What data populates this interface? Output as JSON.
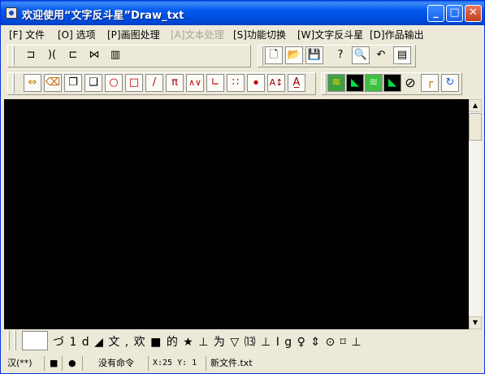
{
  "window": {
    "title": "欢迎使用“文字反斗星”Draw_txt",
    "minimize": "_",
    "maximize": "□",
    "close": "✕"
  },
  "menu": [
    {
      "label": "[F] 文件",
      "disabled": false
    },
    {
      "label": "[O] 选项",
      "disabled": false
    },
    {
      "label": "[P]画图处理",
      "disabled": false
    },
    {
      "label": "[A]文本处理",
      "disabled": true
    },
    {
      "label": "[S]功能切换",
      "disabled": false
    },
    {
      "label": "[W]文字反斗星",
      "disabled": false
    },
    {
      "label": "[D]作品输出",
      "disabled": false
    }
  ],
  "toolbar1_left": [
    "align-left-icon",
    "flip-horizontal-icon",
    "copy-frame-icon",
    "mirror-icon",
    "bar-chart-icon"
  ],
  "toolbar1_right": [
    "new-file-icon",
    "open-folder-icon",
    "save-icon",
    "help-pointer-icon",
    "preview-icon",
    "undo-icon",
    "palette-icon"
  ],
  "toolbar2_draw": [
    {
      "icon": "swap-icon",
      "glyph": "⇔"
    },
    {
      "icon": "eraser-icon",
      "glyph": "⌫"
    },
    {
      "icon": "copy-icon",
      "glyph": "❐"
    },
    {
      "icon": "paste-icon",
      "glyph": "❑"
    },
    {
      "icon": "circle-icon",
      "glyph": "○"
    },
    {
      "icon": "rectangle-icon",
      "glyph": "□"
    },
    {
      "icon": "line-icon",
      "glyph": "/"
    },
    {
      "icon": "table-icon",
      "glyph": "π"
    },
    {
      "icon": "zigzag-icon",
      "glyph": "∧∨"
    },
    {
      "icon": "curve-icon",
      "glyph": "∟"
    },
    {
      "icon": "dots-icon",
      "glyph": "∷"
    },
    {
      "icon": "point-icon",
      "glyph": "∙"
    },
    {
      "icon": "text-size-icon",
      "glyph": "A↕"
    },
    {
      "icon": "text-style-icon",
      "glyph": "A̲"
    }
  ],
  "toolbar2_right": [
    {
      "icon": "gradient-icon",
      "glyph": "≋"
    },
    {
      "icon": "fill-green-icon",
      "glyph": "◣"
    },
    {
      "icon": "gradient-green-icon",
      "glyph": "≋"
    },
    {
      "icon": "fill-dark-icon",
      "glyph": "◣"
    },
    {
      "icon": "no-icon",
      "glyph": "⊘"
    },
    {
      "icon": "corner-icon",
      "glyph": "┌"
    },
    {
      "icon": "refresh-icon",
      "glyph": "↻"
    }
  ],
  "charbar": {
    "chars": "づ 1  d  ◢ 文 ,  欢 ■ 的 ★ ⊥ 为 ▽ ⒀ ⊥ I  g  ♀ ⇕ ⊙ ⌑ ⊥"
  },
  "status": {
    "input_mode": "汉(**)",
    "square": "■",
    "dot": "●",
    "command": "没有命令",
    "position": "X:25 Y: 1",
    "filename": "新文件.txt"
  },
  "colors": {
    "title_blue": "#0058ee",
    "canvas": "#000000",
    "chrome": "#ece9d8"
  }
}
